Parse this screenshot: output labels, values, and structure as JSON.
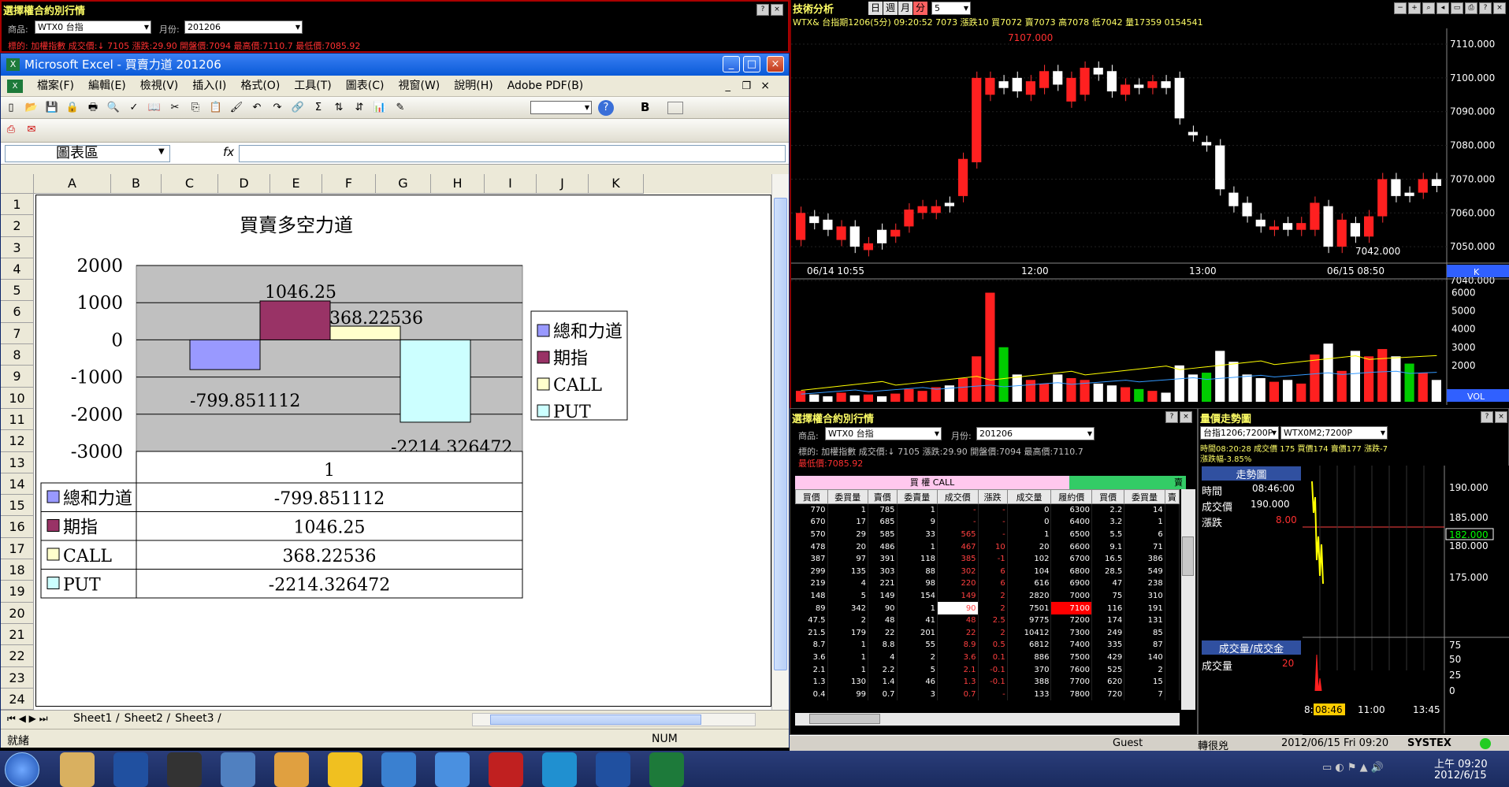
{
  "top_left": {
    "title": "選擇權合約別行情",
    "product_label": "商品:",
    "product_value": "WTX0 台指",
    "month_label": "月份:",
    "month_value": "201206",
    "info_line": "標的: 加權指數  成交價:↓ 7105  漲跌:29.90  開盤價:7094  最高價:7110.7  最低價:7085.92"
  },
  "excel": {
    "window_title": "Microsoft Excel - 買賣力道 201206",
    "menu": [
      "檔案(F)",
      "編輯(E)",
      "檢視(V)",
      "插入(I)",
      "格式(O)",
      "工具(T)",
      "圖表(C)",
      "視窗(W)",
      "說明(H)",
      "Adobe PDF(B)"
    ],
    "name_box": "圖表區",
    "fx": "fx",
    "columns": [
      "A",
      "B",
      "C",
      "D",
      "E",
      "F",
      "G",
      "H",
      "I",
      "J",
      "K"
    ],
    "rows": [
      "1",
      "2",
      "3",
      "4",
      "5",
      "6",
      "7",
      "8",
      "9",
      "10",
      "11",
      "12",
      "13",
      "14",
      "15",
      "16",
      "17",
      "18",
      "19",
      "20",
      "21",
      "22",
      "23",
      "24"
    ],
    "sheets": [
      "Sheet1",
      "Sheet2",
      "Sheet3"
    ],
    "status_ready": "就緒",
    "status_num": "NUM",
    "bold_btn": "B"
  },
  "chart_data": {
    "type": "bar",
    "title": "買賣多空力道",
    "categories": [
      "1"
    ],
    "series": [
      {
        "name": "總和力道",
        "values": [
          -799.851112
        ],
        "color": "#9999ff",
        "label": "-799.851112"
      },
      {
        "name": "期指",
        "values": [
          1046.25
        ],
        "color": "#993366",
        "label": "1046.25"
      },
      {
        "name": "CALL",
        "values": [
          368.22536
        ],
        "color": "#ffffcc",
        "label": "368.22536"
      },
      {
        "name": "PUT",
        "values": [
          -2214.326472
        ],
        "color": "#ccffff",
        "label": "-2214.326472"
      }
    ],
    "ylim": [
      -3000,
      2000
    ],
    "yticks": [
      "2000",
      "1000",
      "0",
      "-1000",
      "-2000",
      "-3000"
    ],
    "xlabel": "",
    "ylabel": "",
    "grid": true,
    "legend": "right",
    "data_table": true
  },
  "tech": {
    "title": "技術分析",
    "periods": [
      "日",
      "週",
      "月",
      "分"
    ],
    "period_num": "5",
    "quote_line": "WTX& 台指期1206(5分) 09:20:52   7073  漲跌10  買7072  賣7073  高7078  低7042  量17359  0154541",
    "hi_label": "7107.000",
    "lo_label": "7042.000",
    "price_axis": [
      "7110.000",
      "7100.000",
      "7090.000",
      "7080.000",
      "7070.000",
      "7060.000",
      "7050.000",
      "7040.000"
    ],
    "time_axis": [
      "06/14 10:55",
      "12:00",
      "13:00",
      "06/15 08:50"
    ],
    "k_tag": "K",
    "vol_axis": [
      "6000",
      "5000",
      "4000",
      "3000",
      "2000"
    ],
    "vol_tag": "VOL"
  },
  "opt": {
    "title": "選擇權合約別行情",
    "product_label": "商品:",
    "product_value": "WTX0 台指",
    "month_label": "月份:",
    "month_value": "201206",
    "info1": "標的: 加權指數  成交價:↓ 7105  漲跌:29.90  開盤價:7094  最高價:7110.7",
    "info2": "最低價:7085.92",
    "call_hdr": "買  權  CALL",
    "put_hdr": "賣",
    "headers": [
      "買價",
      "委買量",
      "賣價",
      "委賣量",
      "成交價",
      "漲跌",
      "成交量",
      "履約價",
      "買價",
      "委買量",
      "賣"
    ],
    "rows": [
      [
        "770",
        "1",
        "785",
        "1",
        "-",
        "-",
        "0",
        "6300",
        "2.2",
        "14"
      ],
      [
        "670",
        "17",
        "685",
        "9",
        "-",
        "-",
        "0",
        "6400",
        "3.2",
        "1"
      ],
      [
        "570",
        "29",
        "585",
        "33",
        "565",
        "-",
        "1",
        "6500",
        "5.5",
        "6"
      ],
      [
        "478",
        "20",
        "486",
        "1",
        "467",
        "10",
        "20",
        "6600",
        "9.1",
        "71"
      ],
      [
        "387",
        "97",
        "391",
        "118",
        "385",
        "-1",
        "102",
        "6700",
        "16.5",
        "386"
      ],
      [
        "299",
        "135",
        "303",
        "88",
        "302",
        "6",
        "104",
        "6800",
        "28.5",
        "549"
      ],
      [
        "219",
        "4",
        "221",
        "98",
        "220",
        "6",
        "616",
        "6900",
        "47",
        "238"
      ],
      [
        "148",
        "5",
        "149",
        "154",
        "149",
        "2",
        "2820",
        "7000",
        "75",
        "310"
      ],
      [
        "89",
        "342",
        "90",
        "1",
        "90",
        "2",
        "7501",
        "7100",
        "116",
        "191"
      ],
      [
        "47.5",
        "2",
        "48",
        "41",
        "48",
        "2.5",
        "9775",
        "7200",
        "174",
        "131"
      ],
      [
        "21.5",
        "179",
        "22",
        "201",
        "22",
        "2",
        "10412",
        "7300",
        "249",
        "85"
      ],
      [
        "8.7",
        "1",
        "8.8",
        "55",
        "8.9",
        "0.5",
        "6812",
        "7400",
        "335",
        "87"
      ],
      [
        "3.6",
        "1",
        "4",
        "2",
        "3.6",
        "0.1",
        "886",
        "7500",
        "429",
        "140"
      ],
      [
        "2.1",
        "1",
        "2.2",
        "5",
        "2.1",
        "-0.1",
        "370",
        "7600",
        "525",
        "2"
      ],
      [
        "1.3",
        "130",
        "1.4",
        "46",
        "1.3",
        "-0.1",
        "388",
        "7700",
        "620",
        "15"
      ],
      [
        "0.4",
        "99",
        "0.7",
        "3",
        "0.7",
        "-",
        "133",
        "7800",
        "720",
        "7"
      ]
    ]
  },
  "trend": {
    "title": "量價走勢圖",
    "combo1": "台指1206;7200P",
    "combo2": "WTX0M2;7200P",
    "info": "時間08:20:28  成交價  175  買價174  賣價177  漲跌-7",
    "info2": "漲跌幅-3.85%",
    "tab1": "走勢圖",
    "time_label": "時間",
    "time_val": "08:46:00",
    "price_label": "成交價",
    "price_val": "190.000",
    "chg_label": "漲跌",
    "chg_val": "8.00",
    "axis": [
      "190.000",
      "185.000",
      "182.000",
      "180.000",
      "175.000"
    ],
    "tab2": "成交量/成交金",
    "vol_label": "成交量",
    "vol_val": "20",
    "vol_axis": [
      "75",
      "50",
      "25",
      "0"
    ],
    "time_axis": [
      "8:",
      "08:46",
      "11:00",
      "13:45"
    ]
  },
  "status": {
    "user": "Guest",
    "name": "轉很兇",
    "datetime": "2012/06/15 Fri 09:20",
    "brand": "SYSTEX"
  },
  "taskbar": {
    "time": "上午 09:20",
    "date": "2012/6/15"
  }
}
